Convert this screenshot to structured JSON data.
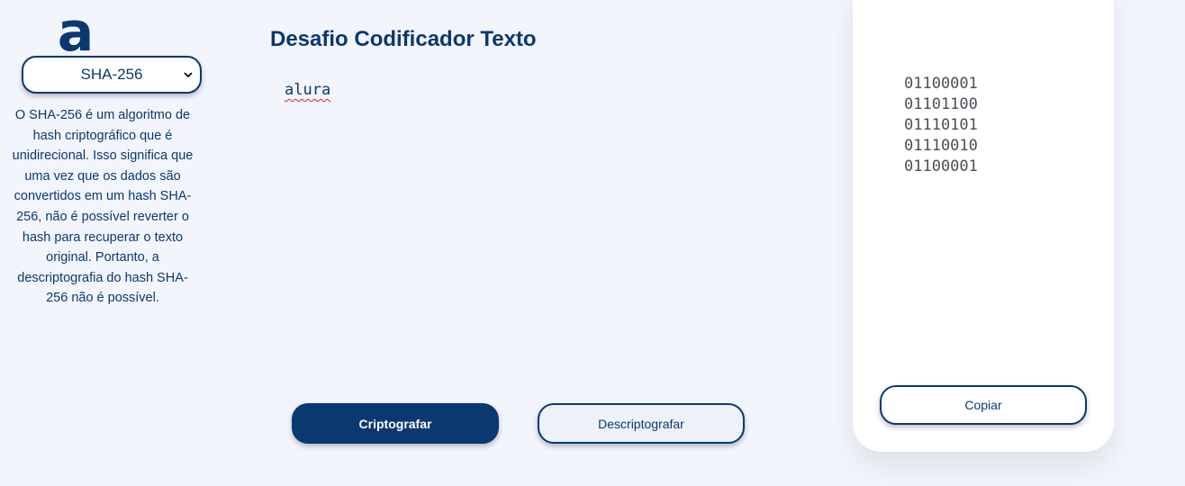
{
  "brand": {
    "logo_letter": "a",
    "accent_color": "#0a3871"
  },
  "sidebar": {
    "algorithm_select": {
      "value": "SHA-256",
      "icon": "chevron-down-icon"
    },
    "description": "O SHA-256 é um algoritmo de hash criptográfico que é unidirecional. Isso significa que uma vez que os dados são convertidos em um hash SHA-256, não é possível reverter o hash para recuperar o texto original. Portanto, a descriptografia do hash SHA-256 não é possível."
  },
  "main": {
    "title": "Desafio Codificador Texto",
    "input_text": "alura",
    "encrypt_label": "Criptografar",
    "decrypt_label": "Descriptografar"
  },
  "output": {
    "lines": [
      "01100001",
      "01101100",
      "01110101",
      "01110010",
      "01100001"
    ],
    "copy_label": "Copiar"
  }
}
